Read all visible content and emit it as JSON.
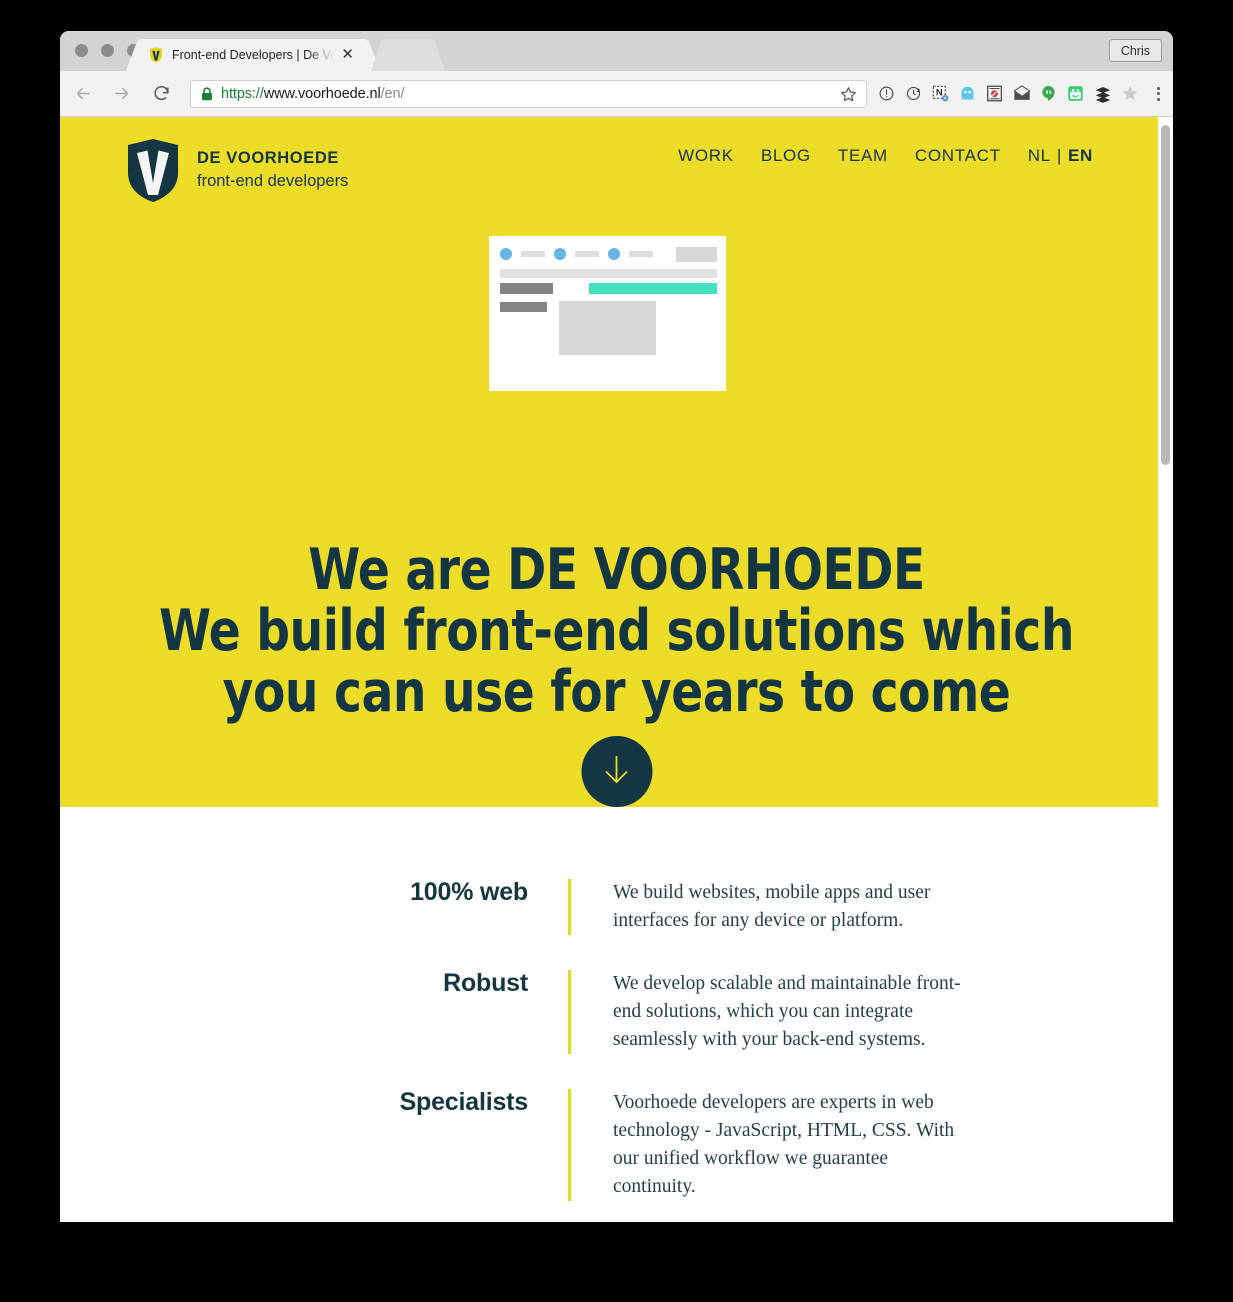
{
  "browser": {
    "tab": {
      "title": "Front-end Developers | De Voo",
      "favicon_icon": "voorhoede-shield-favicon",
      "close_icon": "close-icon"
    },
    "profile_label": "Chris",
    "nav": {
      "back_icon": "back-arrow-icon",
      "forward_icon": "forward-arrow-icon",
      "reload_icon": "reload-icon"
    },
    "omnibox": {
      "lock_icon": "lock-icon",
      "scheme": "https://",
      "host": "www.voorhoede.nl",
      "path": "/en/",
      "full_url": "https://www.voorhoede.nl/en/",
      "star_icon": "star-icon"
    },
    "extensions": [
      {
        "icon": "info-circle-icon",
        "label": "ⓘ"
      },
      {
        "icon": "refresh-clock-icon",
        "label": "↻"
      },
      {
        "icon": "evernote-clipper-icon",
        "label": "N"
      },
      {
        "icon": "ghostery-icon",
        "label": "👻"
      },
      {
        "icon": "adblock-icon",
        "label": "⛔"
      },
      {
        "icon": "mailbox-icon",
        "label": "✉"
      },
      {
        "icon": "hangouts-icon",
        "label": "💬"
      },
      {
        "icon": "bitmoji-icon",
        "label": "😀"
      },
      {
        "icon": "buffer-icon",
        "label": "≡"
      },
      {
        "icon": "wappalyzer-icon",
        "label": "✳"
      }
    ],
    "menu_icon": "three-dot-menu-icon",
    "scrollbar": "vertical-scrollbar"
  },
  "site": {
    "brand": {
      "logo_icon": "voorhoede-shield-logo",
      "name": "DE VOORHOEDE",
      "tagline": "front-end developers"
    },
    "nav_links": [
      {
        "label": "WORK"
      },
      {
        "label": "BLOG"
      },
      {
        "label": "TEAM"
      },
      {
        "label": "CONTACT"
      }
    ],
    "language": {
      "inactive": "NL",
      "separator": "|",
      "active": "EN"
    },
    "hero": {
      "illustration_icon": "browser-wireframe-illustration",
      "line1_lead": "We are ",
      "line1_strong": "DE VOORHOEDE",
      "line2": "We build front-end solutions which",
      "line3": "you can use for years to come",
      "scroll_cue_icon": "arrow-down-icon"
    },
    "features": [
      {
        "title": "100% web",
        "body": "We build websites, mobile apps and user interfaces for any device or platform."
      },
      {
        "title": "Robust",
        "body": "We develop scalable and maintainable front-end solutions, which you can integrate seamlessly with your back-end systems."
      },
      {
        "title": "Specialists",
        "body": "Voorhoede developers are experts in web technology - JavaScript, HTML, CSS. With our unified workflow we guarantee continuity."
      }
    ]
  },
  "colors": {
    "brand_yellow": "#EDDC28",
    "brand_navy": "#143642",
    "accent_teal": "#46DFC0",
    "accent_blue": "#64B4E6",
    "rule_yellow": "#E8D618"
  }
}
